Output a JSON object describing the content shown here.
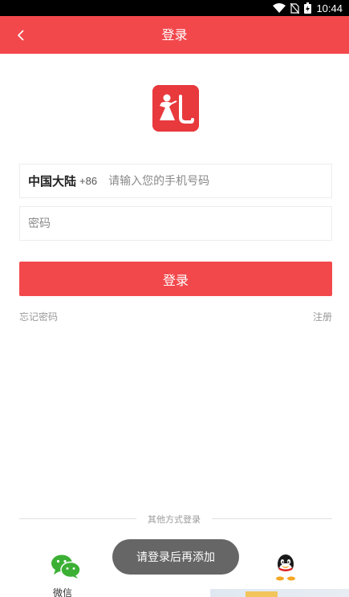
{
  "status_bar": {
    "time": "10:44",
    "icons": [
      "wifi-icon",
      "no-sim-icon",
      "battery-icon"
    ]
  },
  "header": {
    "title": "登录",
    "back_icon": "chevron-left-icon",
    "background_color": "#f2484c"
  },
  "logo": {
    "icon": "app-logo-icon",
    "color": "#e8393d"
  },
  "phone_field": {
    "region": "中国大陆",
    "country_code": "+86",
    "placeholder": "请输入您的手机号码",
    "value": ""
  },
  "password_field": {
    "placeholder": "密码",
    "value": ""
  },
  "login_button": {
    "label": "登录"
  },
  "links": {
    "forgot_password": "忘记密码",
    "register": "注册"
  },
  "other_login": {
    "title": "其他方式登录",
    "methods": [
      {
        "label": "微信",
        "icon": "wechat-icon"
      },
      {
        "label": "",
        "icon": "qq-icon"
      }
    ]
  },
  "toast": {
    "message": "请登录后再添加"
  }
}
